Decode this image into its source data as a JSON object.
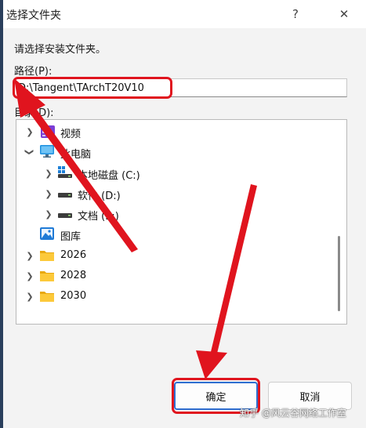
{
  "window": {
    "title": "选择文件夹",
    "help_glyph": "?",
    "close_glyph": "✕"
  },
  "dialog": {
    "prompt": "请选择安装文件夹。",
    "path_label": "路径(P):",
    "path_value": "D:\\Tangent\\TArchT20V10",
    "dir_label": "目录(D):"
  },
  "tree": [
    {
      "label": "视频",
      "icon": "video-folder-icon",
      "expanded": false
    },
    {
      "label": "此电脑",
      "icon": "computer-icon",
      "expanded": true
    },
    {
      "label": "本地磁盘 (C:)",
      "icon": "windows-drive-icon",
      "expanded": false
    },
    {
      "label": "软件 (D:)",
      "icon": "drive-icon",
      "expanded": false
    },
    {
      "label": "文档 (E:)",
      "icon": "drive-icon",
      "expanded": false
    },
    {
      "label": "图库",
      "icon": "gallery-icon",
      "expanded": false
    },
    {
      "label": "2026",
      "icon": "folder-icon",
      "expanded": false
    },
    {
      "label": "2028",
      "icon": "folder-icon",
      "expanded": false
    },
    {
      "label": "2030",
      "icon": "folder-icon",
      "expanded": false
    }
  ],
  "buttons": {
    "ok": "确定",
    "cancel": "取消"
  },
  "annotation_color": "#e0141e",
  "watermark": "知乎 @风云谷网络工作室"
}
